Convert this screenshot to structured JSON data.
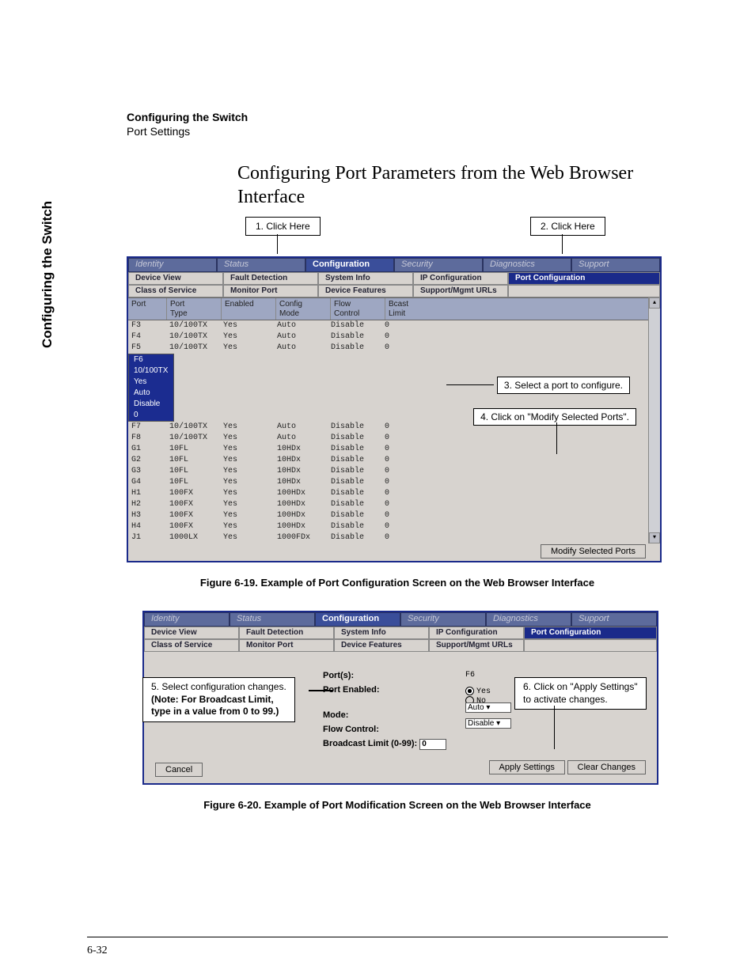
{
  "header": {
    "title": "Configuring the Switch",
    "subtitle": "Port Settings"
  },
  "side_tab": "Configuring the Switch",
  "page_title": "Configuring Port Parameters from the Web Browser Interface",
  "callouts": {
    "one": "1. Click Here",
    "two": "2. Click Here"
  },
  "annotations": {
    "a3": "3. Select a port to configure.",
    "a4": "4. Click on \"Modify Selected Ports\".",
    "a5_line1": "5. Select configuration changes.",
    "a5_line2": "(Note: For Broadcast Limit,",
    "a5_line3": "type in a value from 0 to 99.)",
    "a6_line1": "6. Click on \"Apply Settings\"",
    "a6_line2": "to activate changes."
  },
  "top_tabs": [
    "Identity",
    "Status",
    "Configuration",
    "Security",
    "Diagnostics",
    "Support"
  ],
  "top_tabs_active": 2,
  "sub_tabs_row1": [
    "Device View",
    "Fault Detection",
    "System Info",
    "IP Configuration",
    "Port Configuration"
  ],
  "sub_tabs_row2": [
    "Class of Service",
    "Monitor Port",
    "Device Features",
    "Support/Mgmt URLs"
  ],
  "sub_tab_active": "Port Configuration",
  "columns": {
    "port": "Port",
    "type": "Port\nType",
    "enabled": "Enabled",
    "mode": "Config\nMode",
    "flow": "Flow\nControl",
    "bcast": "Bcast\nLimit"
  },
  "rows": [
    {
      "port": "F3",
      "type": "10/100TX",
      "enabled": "Yes",
      "mode": "Auto",
      "flow": "Disable",
      "bcast": "0"
    },
    {
      "port": "F4",
      "type": "10/100TX",
      "enabled": "Yes",
      "mode": "Auto",
      "flow": "Disable",
      "bcast": "0"
    },
    {
      "port": "F5",
      "type": "10/100TX",
      "enabled": "Yes",
      "mode": "Auto",
      "flow": "Disable",
      "bcast": "0"
    },
    {
      "port": "F6",
      "type": "10/100TX",
      "enabled": "Yes",
      "mode": "Auto",
      "flow": "Disable",
      "bcast": "0",
      "selected": true
    },
    {
      "port": "F7",
      "type": "10/100TX",
      "enabled": "Yes",
      "mode": "Auto",
      "flow": "Disable",
      "bcast": "0"
    },
    {
      "port": "F8",
      "type": "10/100TX",
      "enabled": "Yes",
      "mode": "Auto",
      "flow": "Disable",
      "bcast": "0"
    },
    {
      "port": "G1",
      "type": "10FL",
      "enabled": "Yes",
      "mode": "10HDx",
      "flow": "Disable",
      "bcast": "0"
    },
    {
      "port": "G2",
      "type": "10FL",
      "enabled": "Yes",
      "mode": "10HDx",
      "flow": "Disable",
      "bcast": "0"
    },
    {
      "port": "G3",
      "type": "10FL",
      "enabled": "Yes",
      "mode": "10HDx",
      "flow": "Disable",
      "bcast": "0"
    },
    {
      "port": "G4",
      "type": "10FL",
      "enabled": "Yes",
      "mode": "10HDx",
      "flow": "Disable",
      "bcast": "0"
    },
    {
      "port": "H1",
      "type": "100FX",
      "enabled": "Yes",
      "mode": "100HDx",
      "flow": "Disable",
      "bcast": "0"
    },
    {
      "port": "H2",
      "type": "100FX",
      "enabled": "Yes",
      "mode": "100HDx",
      "flow": "Disable",
      "bcast": "0"
    },
    {
      "port": "H3",
      "type": "100FX",
      "enabled": "Yes",
      "mode": "100HDx",
      "flow": "Disable",
      "bcast": "0"
    },
    {
      "port": "H4",
      "type": "100FX",
      "enabled": "Yes",
      "mode": "100HDx",
      "flow": "Disable",
      "bcast": "0"
    },
    {
      "port": "J1",
      "type": "1000LX",
      "enabled": "Yes",
      "mode": "1000FDx",
      "flow": "Disable",
      "bcast": "0"
    }
  ],
  "modify_btn": "Modify Selected Ports",
  "caption1": "Figure 6-19.  Example of Port Configuration Screen on the Web Browser Interface",
  "form": {
    "ports_label": "Port(s):",
    "ports_value": "F6",
    "enabled_label": "Port Enabled:",
    "enabled_yes": "Yes",
    "enabled_no": "No",
    "mode_label": "Mode:",
    "mode_value": "Auto",
    "flow_label": "Flow Control:",
    "flow_value": "Disable",
    "bcast_label": "Broadcast Limit (0-99):",
    "bcast_value": "0",
    "cancel": "Cancel",
    "apply": "Apply Settings",
    "clear": "Clear Changes"
  },
  "caption2": "Figure 6-20.  Example of Port Modification Screen on the Web Browser Interface",
  "page_num": "6-32"
}
